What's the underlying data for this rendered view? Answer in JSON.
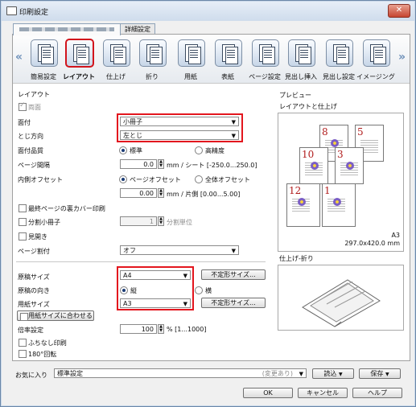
{
  "window": {
    "title": "印刷設定",
    "close": "✕"
  },
  "tabs": {
    "blurred": "",
    "detail": "詳細設定"
  },
  "iconbar": {
    "left_arrow": "«",
    "right_arrow": "»",
    "items": [
      {
        "label": "簡易設定",
        "icon": "quick-setup-icon"
      },
      {
        "label": "レイアウト",
        "icon": "layout-icon"
      },
      {
        "label": "仕上げ",
        "icon": "finishing-icon"
      },
      {
        "label": "折り",
        "icon": "fold-icon"
      },
      {
        "label": "用紙",
        "icon": "paper-icon"
      },
      {
        "label": "表紙",
        "icon": "cover-icon"
      },
      {
        "label": "ページ設定",
        "icon": "page-setup-icon"
      },
      {
        "label": "見出し挿入",
        "icon": "tab-insert-icon"
      },
      {
        "label": "見出し設定",
        "icon": "tab-setting-icon"
      },
      {
        "label": "イメージング",
        "icon": "imaging-icon"
      }
    ]
  },
  "layout": {
    "section": "レイアウト",
    "duplex_label": "両面",
    "duplex_checked": true,
    "layout_label": "面付",
    "layout_value": "小冊子",
    "binding_label": "とじ方向",
    "binding_value": "左とじ",
    "quality_label": "面付品質",
    "quality_opt1": "標準",
    "quality_opt2": "高精度",
    "spacing_label": "ページ間隔",
    "spacing_value": "0.0",
    "spacing_unit": "mm / シート [-250.0...250.0]",
    "offset_label": "内側オフセット",
    "offset_opt1": "ページオフセット",
    "offset_opt2": "全体オフセット",
    "offset_value": "0.00",
    "offset_unit": "mm / 片側 [0.00...5.00]",
    "back_cover": "最終ページの裏カバー印刷",
    "split_booklet": "分割小冊子",
    "split_value": "1",
    "split_unit": "分割単位",
    "spread": "見開き",
    "page_split_label": "ページ割付",
    "page_split_value": "オフ"
  },
  "paper": {
    "orig_size_label": "原稿サイズ",
    "orig_size_value": "A4",
    "custom_size_btn": "不定形サイズ...",
    "orientation_label": "原稿の向き",
    "orientation_portrait": "縦",
    "orientation_landscape": "横",
    "paper_size_label": "用紙サイズ",
    "paper_size_value": "A3",
    "custom_size_btn2": "不定形サイズ...",
    "fit_paper_btn": "用紙サイズに合わせる",
    "zoom_label": "倍率設定",
    "zoom_value": "100",
    "zoom_unit": "% [1...1000]",
    "borderless": "ふちなし印刷",
    "rotate180": "180°回転"
  },
  "preview": {
    "title": "プレビュー",
    "subtitle": "レイアウトと仕上げ",
    "pages": [
      "8",
      "5",
      "10",
      "3",
      "12",
      "1"
    ],
    "paper_name": "A3",
    "paper_dims": "297.0x420.0 mm",
    "fold_title": "仕上げ-折り"
  },
  "footer": {
    "favorites_label": "お気に入り",
    "favorites_value": "標準設定",
    "changed": "(変更あり)",
    "load_btn": "読込",
    "save_btn": "保存",
    "ok_btn": "OK",
    "cancel_btn": "キャンセル",
    "help_btn": "ヘルプ"
  }
}
